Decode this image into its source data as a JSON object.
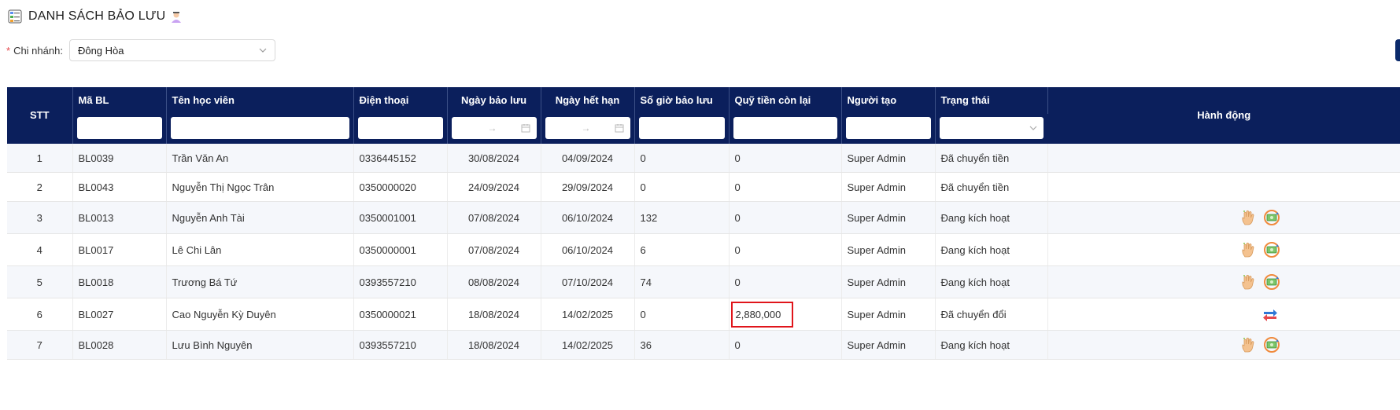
{
  "header": {
    "title": "DANH SÁCH BẢO LƯU"
  },
  "branch": {
    "label": "Chi nhánh:",
    "required_mark": "*",
    "value": "Đông Hòa"
  },
  "table": {
    "columns": {
      "stt": "STT",
      "ma_bl": "Mã BL",
      "ten": "Tên học viên",
      "dien_thoai": "Điện thoại",
      "ngay_bao_luu": "Ngày bảo lưu",
      "ngay_het_han": "Ngày hết hạn",
      "so_gio": "Số giờ bảo lưu",
      "quy_tien": "Quỹ tiền còn lại",
      "nguoi_tao": "Người tạo",
      "trang_thai": "Trạng thái",
      "hanh_dong": "Hành động"
    },
    "date_range_arrow": "→",
    "rows": [
      {
        "stt": "1",
        "ma": "BL0039",
        "ten": "Trần Văn An",
        "sdt": "0336445152",
        "ngay_bl": "30/08/2024",
        "ngay_hh": "04/09/2024",
        "gio": "0",
        "quy": "0",
        "nguoi_tao": "Super Admin",
        "trang_thai": "Đã chuyển tiền",
        "actions": []
      },
      {
        "stt": "2",
        "ma": "BL0043",
        "ten": "Nguyễn Thị Ngọc Trân",
        "sdt": "0350000020",
        "ngay_bl": "24/09/2024",
        "ngay_hh": "29/09/2024",
        "gio": "0",
        "quy": "0",
        "nguoi_tao": "Super Admin",
        "trang_thai": "Đã chuyển tiền",
        "actions": []
      },
      {
        "stt": "3",
        "ma": "BL0013",
        "ten": "Nguyễn Anh Tài",
        "sdt": "0350001001",
        "ngay_bl": "07/08/2024",
        "ngay_hh": "06/10/2024",
        "gio": "132",
        "quy": "0",
        "nguoi_tao": "Super Admin",
        "trang_thai": "Đang kích hoạt",
        "actions": [
          "hand-icon",
          "money-refund-icon"
        ]
      },
      {
        "stt": "4",
        "ma": "BL0017",
        "ten": "Lê Chi Lân",
        "sdt": "0350000001",
        "ngay_bl": "07/08/2024",
        "ngay_hh": "06/10/2024",
        "gio": "6",
        "quy": "0",
        "nguoi_tao": "Super Admin",
        "trang_thai": "Đang kích hoạt",
        "actions": [
          "hand-icon",
          "money-refund-icon"
        ]
      },
      {
        "stt": "5",
        "ma": "BL0018",
        "ten": "Trương Bá Tứ",
        "sdt": "0393557210",
        "ngay_bl": "08/08/2024",
        "ngay_hh": "07/10/2024",
        "gio": "74",
        "quy": "0",
        "nguoi_tao": "Super Admin",
        "trang_thai": "Đang kích hoạt",
        "actions": [
          "hand-icon",
          "money-refund-icon"
        ]
      },
      {
        "stt": "6",
        "ma": "BL0027",
        "ten": "Cao Nguyễn Kỳ Duyên",
        "sdt": "0350000021",
        "ngay_bl": "18/08/2024",
        "ngay_hh": "14/02/2025",
        "gio": "0",
        "quy": "2,880,000",
        "nguoi_tao": "Super Admin",
        "trang_thai": "Đã chuyển đổi",
        "actions": [
          "transfer-arrows-icon"
        ]
      },
      {
        "stt": "7",
        "ma": "BL0028",
        "ten": "Lưu Bình Nguyên",
        "sdt": "0393557210",
        "ngay_bl": "18/08/2024",
        "ngay_hh": "14/02/2025",
        "gio": "36",
        "quy": "0",
        "nguoi_tao": "Super Admin",
        "trang_thai": "Đang kích hoạt",
        "actions": [
          "hand-icon",
          "money-refund-icon"
        ]
      }
    ]
  },
  "colors": {
    "header_bg": "#0b1f5c",
    "highlight_border": "#e0151b",
    "row_alt": "#f5f7fb"
  }
}
